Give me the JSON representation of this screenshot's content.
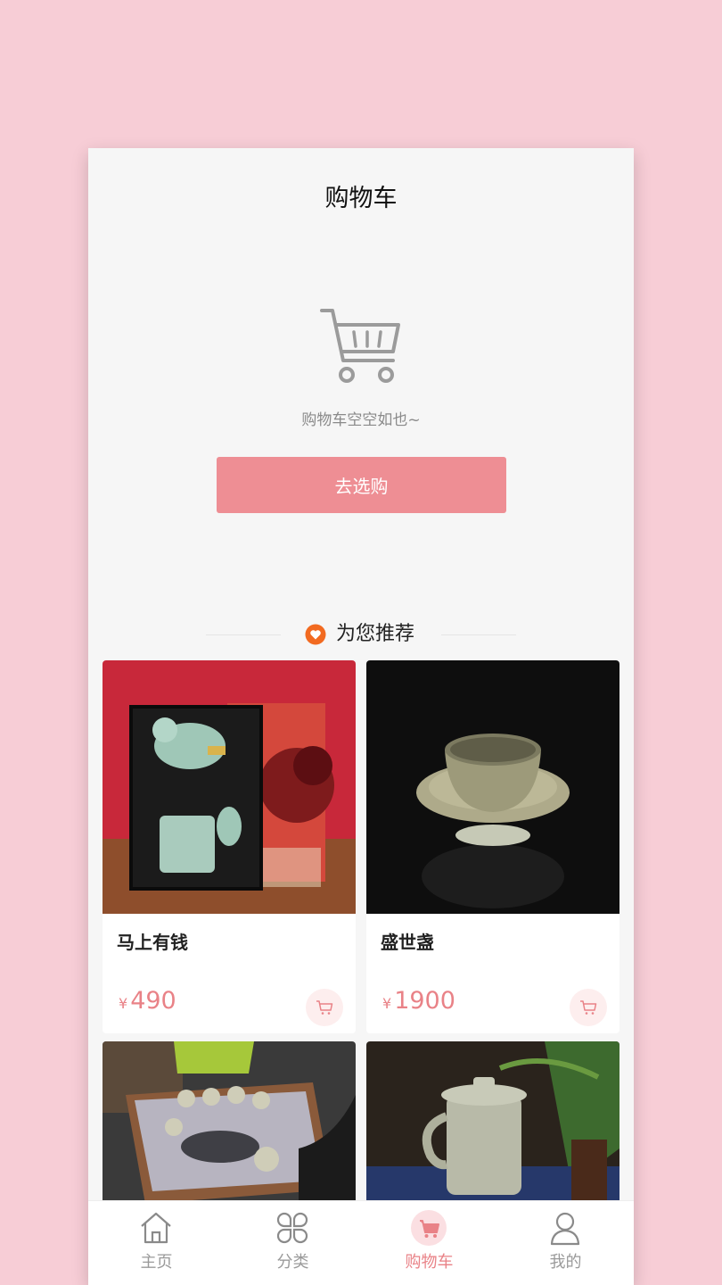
{
  "header": {
    "title": "购物车"
  },
  "empty_state": {
    "icon": "shopping-cart-icon",
    "message": "购物车空空如也~",
    "button_label": "去选购"
  },
  "recommend": {
    "icon": "heart-icon",
    "title": "为您推荐",
    "products": [
      {
        "name": "马上有钱",
        "currency": "¥",
        "price": "490"
      },
      {
        "name": "盛世盏",
        "currency": "¥",
        "price": "1900"
      },
      {
        "name": "",
        "currency": "",
        "price": ""
      },
      {
        "name": "",
        "currency": "",
        "price": ""
      }
    ]
  },
  "tabbar": {
    "items": [
      {
        "label": "主页",
        "icon": "home-icon"
      },
      {
        "label": "分类",
        "icon": "category-icon"
      },
      {
        "label": "购物车",
        "icon": "cart-icon",
        "active": true
      },
      {
        "label": "我的",
        "icon": "user-icon"
      }
    ]
  },
  "colors": {
    "accent": "#ee8e94",
    "price": "#e98287",
    "background": "#f7cdd6"
  }
}
